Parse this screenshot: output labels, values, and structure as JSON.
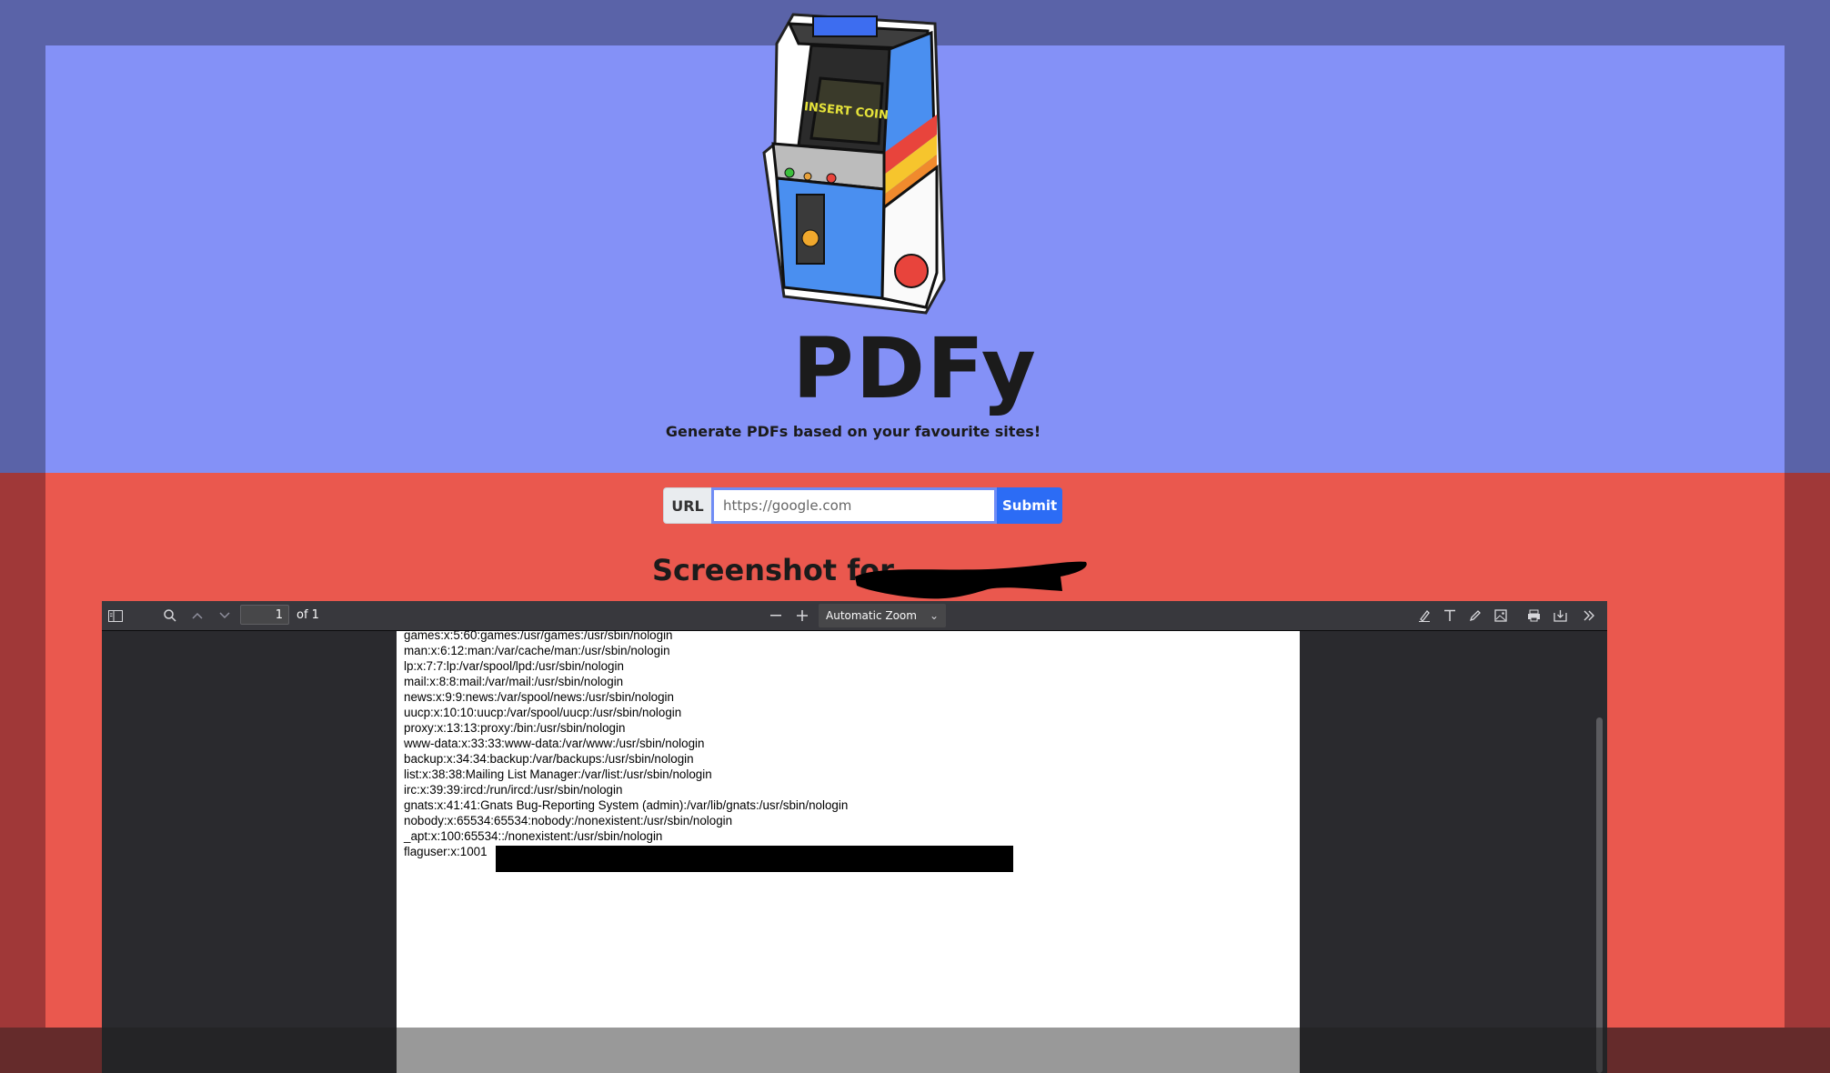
{
  "app": {
    "title": "PDFy",
    "subtitle": "Generate PDFs based on your favourite sites!",
    "logo_icon": "arcade-cabinet-icon",
    "logo_text": "INSERT COIN"
  },
  "form": {
    "label": "URL",
    "placeholder": "https://google.com",
    "submit_label": "Submit"
  },
  "result": {
    "heading": "Screenshot for"
  },
  "pdf_viewer": {
    "page_number": "1",
    "page_count": "of 1",
    "zoom": "Automatic Zoom",
    "lines": [
      "games:x:5:60:games:/usr/games:/usr/sbin/nologin",
      "man:x:6:12:man:/var/cache/man:/usr/sbin/nologin",
      "lp:x:7:7:lp:/var/spool/lpd:/usr/sbin/nologin",
      "mail:x:8:8:mail:/var/mail:/usr/sbin/nologin",
      "news:x:9:9:news:/var/spool/news:/usr/sbin/nologin",
      "uucp:x:10:10:uucp:/var/spool/uucp:/usr/sbin/nologin",
      "proxy:x:13:13:proxy:/bin:/usr/sbin/nologin",
      "www-data:x:33:33:www-data:/var/www:/usr/sbin/nologin",
      "backup:x:34:34:backup:/var/backups:/usr/sbin/nologin",
      "list:x:38:38:Mailing List Manager:/var/list:/usr/sbin/nologin",
      "irc:x:39:39:ircd:/run/ircd:/usr/sbin/nologin",
      "gnats:x:41:41:Gnats Bug-Reporting System (admin):/var/lib/gnats:/usr/sbin/nologin",
      "nobody:x:65534:65534:nobody:/nonexistent:/usr/sbin/nologin",
      "_apt:x:100:65534::/nonexistent:/usr/sbin/nologin",
      "flaguser:x:1001"
    ]
  },
  "colors": {
    "top_panel": "#8491f7",
    "bottom_panel": "#ea584e",
    "submit": "#2c6cf5"
  }
}
